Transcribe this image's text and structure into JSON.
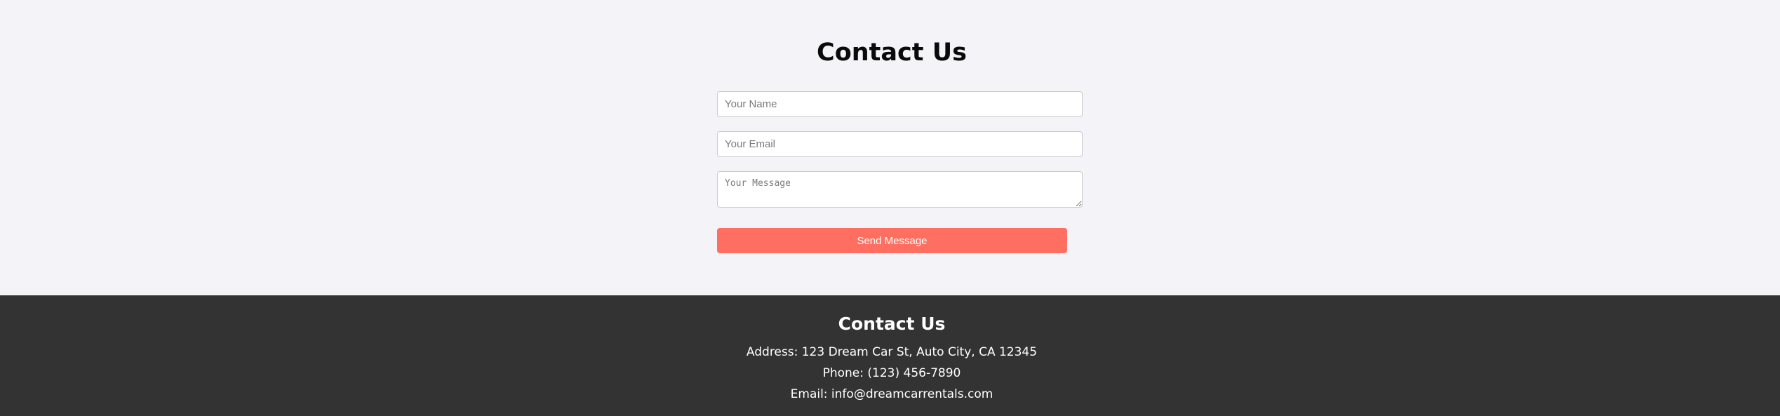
{
  "contact_form": {
    "title": "Contact Us",
    "name_placeholder": "Your Name",
    "email_placeholder": "Your Email",
    "message_placeholder": "Your Message",
    "submit_label": "Send Message"
  },
  "footer": {
    "title": "Contact Us",
    "address": "Address: 123 Dream Car St, Auto City, CA 12345",
    "phone": "Phone: (123) 456-7890",
    "email": "Email: info@dreamcarrentals.com"
  },
  "colors": {
    "page_background": "#f4f4f8",
    "footer_background": "#333333",
    "button_background": "#ff6f61",
    "button_text": "#ffffff"
  }
}
